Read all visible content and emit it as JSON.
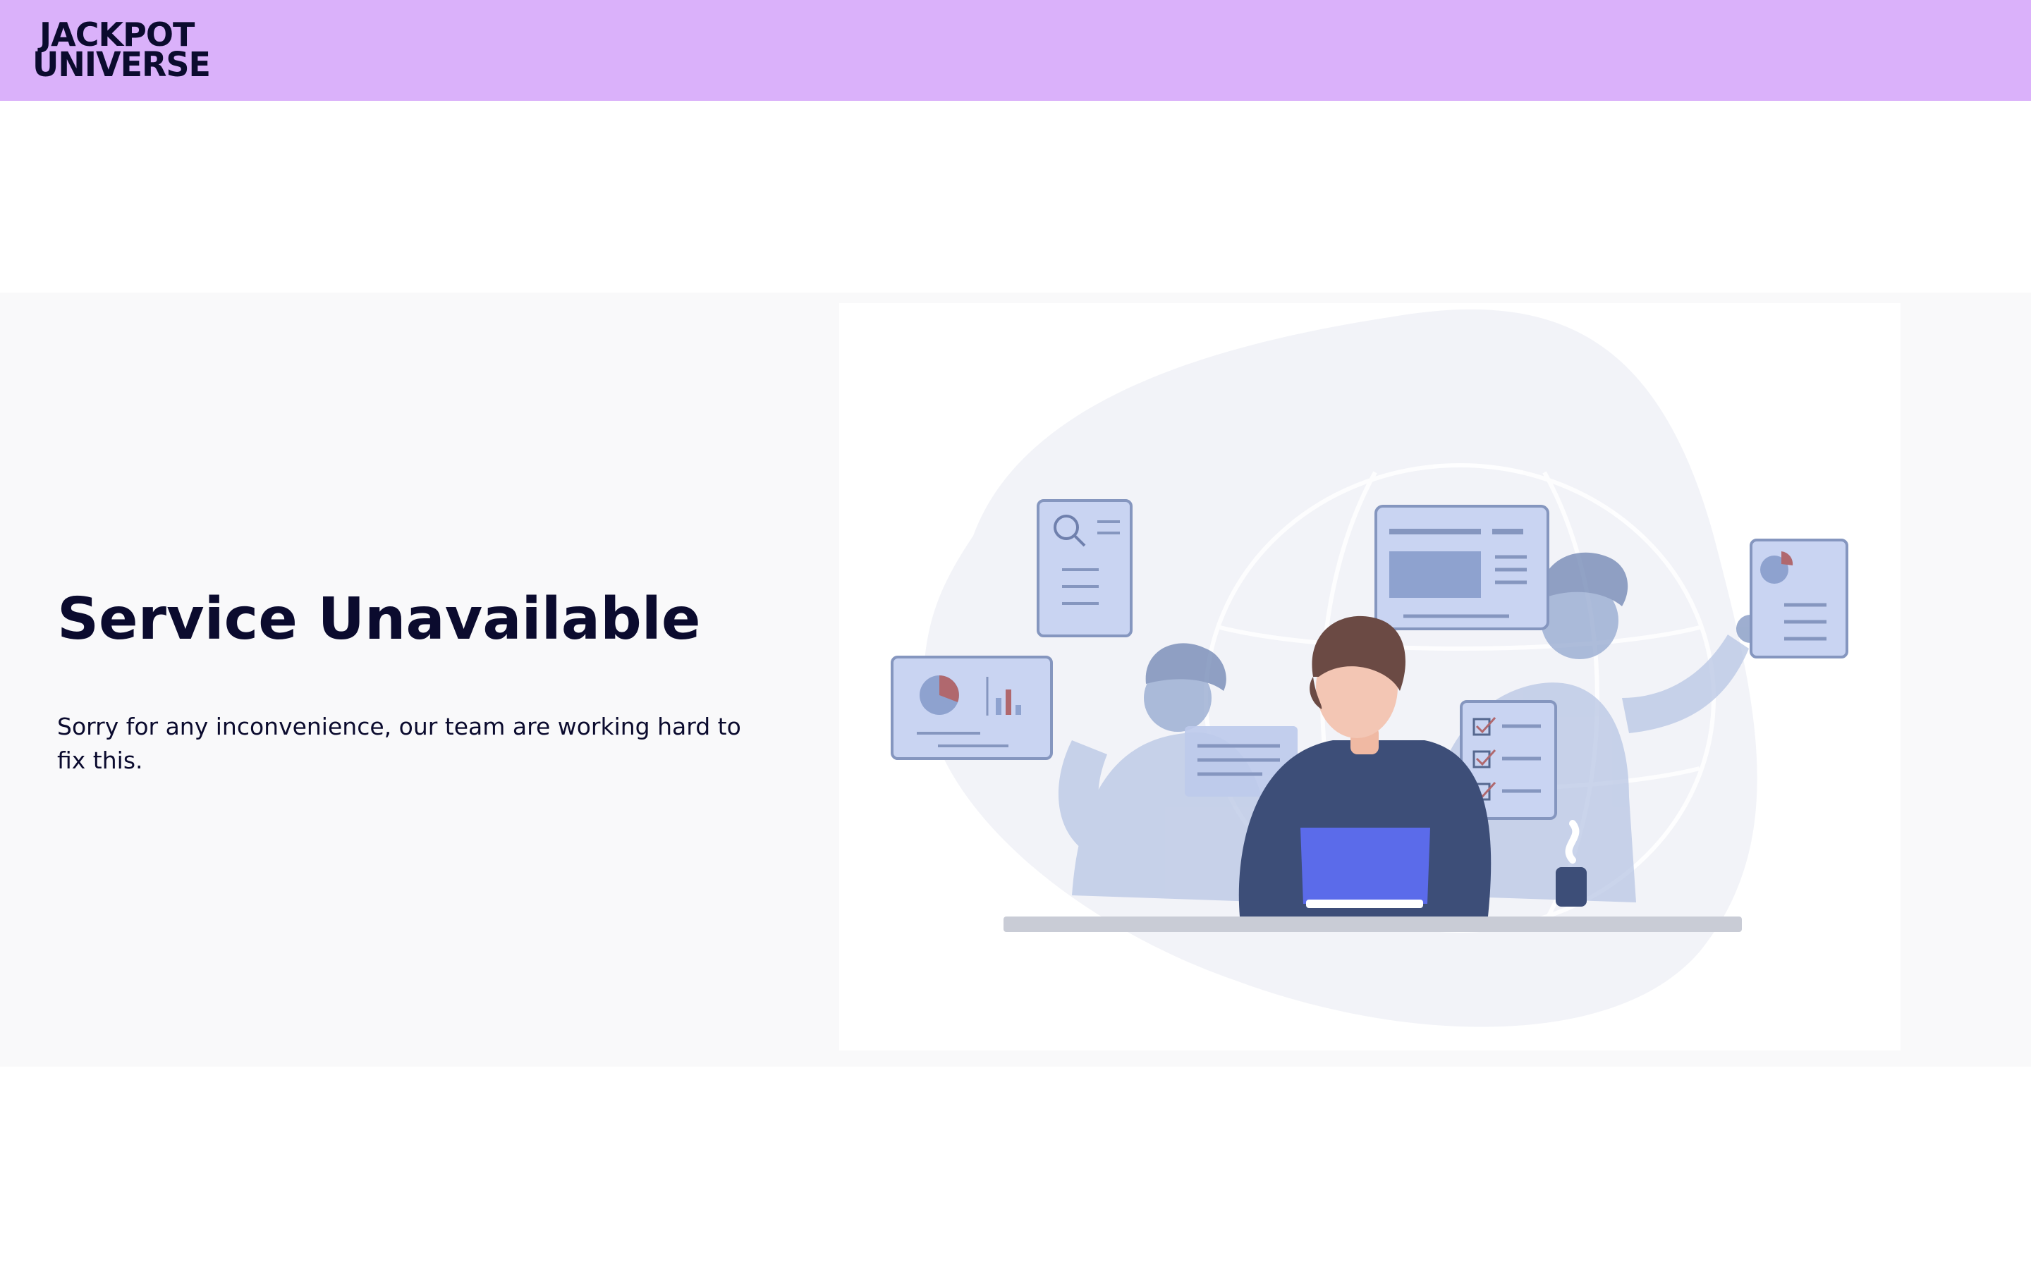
{
  "header": {
    "logo": {
      "line1": "JACKPOT",
      "line2": "UNIVERSE",
      "text_color": "#0b0b2e"
    },
    "background_color": "#dab1fa"
  },
  "main": {
    "title": "Service Unavailable",
    "message": "Sorry for any inconvenience, our team are working hard to fix this.",
    "illustration": "team-working-at-laptop-illustration",
    "background_color": "#f9f9fa"
  },
  "colors": {
    "text": "#0b0b2e",
    "accent_blue": "#5b6bea",
    "panel_blue": "#c6d2f2",
    "figure_dark": "#3d4e78"
  }
}
